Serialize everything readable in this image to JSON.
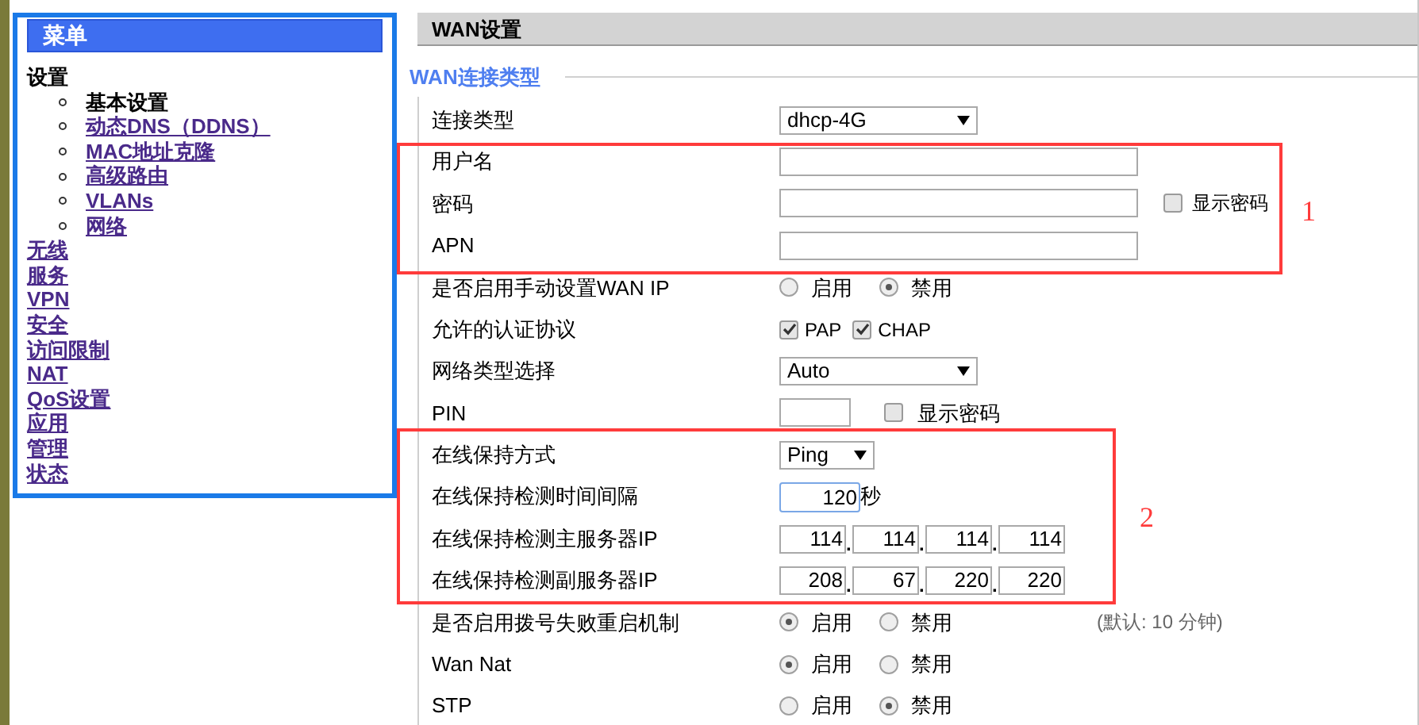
{
  "sidebar": {
    "title": "菜单",
    "items": [
      {
        "label": "设置",
        "selected": true,
        "children": [
          {
            "label": "基本设置",
            "selected": true
          },
          {
            "label": "动态DNS（DDNS）",
            "selected": false
          },
          {
            "label": "MAC地址克隆",
            "selected": false
          },
          {
            "label": "高级路由",
            "selected": false
          },
          {
            "label": "VLANs",
            "selected": false
          },
          {
            "label": "网络",
            "selected": false
          }
        ]
      },
      {
        "label": "无线",
        "selected": false
      },
      {
        "label": "服务",
        "selected": false
      },
      {
        "label": "VPN",
        "selected": false
      },
      {
        "label": "安全",
        "selected": false
      },
      {
        "label": "访问限制",
        "selected": false
      },
      {
        "label": "NAT",
        "selected": false
      },
      {
        "label": "QoS设置",
        "selected": false
      },
      {
        "label": "应用",
        "selected": false
      },
      {
        "label": "管理",
        "selected": false
      },
      {
        "label": "状态",
        "selected": false
      }
    ]
  },
  "page_title": "WAN设置",
  "section": {
    "title": "WAN连接类型",
    "rows": [
      {
        "kind": "select",
        "label": "连接类型",
        "value": "dhcp-4G"
      },
      {
        "kind": "text",
        "label": "用户名"
      },
      {
        "kind": "password",
        "label": "密码",
        "show_password": {
          "label": "显示密码",
          "checked": false
        }
      },
      {
        "kind": "text",
        "label": "APN"
      },
      {
        "kind": "radio",
        "label": "是否启用手动设置WAN IP",
        "options": [
          {
            "label": "启用",
            "selected": false
          },
          {
            "label": "禁用",
            "selected": true
          }
        ]
      },
      {
        "kind": "checks",
        "label": "允许的认证协议",
        "options": [
          {
            "label": "PAP",
            "checked": true
          },
          {
            "label": "CHAP",
            "checked": true
          }
        ]
      },
      {
        "kind": "select",
        "label": "网络类型选择",
        "value": "Auto"
      },
      {
        "kind": "pin",
        "label": "PIN",
        "show_password": {
          "label": "显示密码",
          "checked": false
        }
      },
      {
        "kind": "shortselect",
        "label": "在线保持方式",
        "value": "Ping"
      },
      {
        "kind": "interval",
        "label": "在线保持检测时间间隔",
        "value": "120",
        "unit": "秒"
      },
      {
        "kind": "ip",
        "label": "在线保持检测主服务器IP",
        "octets": [
          "114",
          "114",
          "114",
          "114"
        ],
        "separators": [
          ".",
          ".",
          "."
        ]
      },
      {
        "kind": "ip",
        "label": "在线保持检测副服务器IP",
        "octets": [
          "208",
          "67",
          "220",
          "220"
        ],
        "separators": [
          ".",
          ".",
          "."
        ]
      },
      {
        "kind": "radio",
        "label": "是否启用拨号失败重启机制",
        "options": [
          {
            "label": "启用",
            "selected": true
          },
          {
            "label": "禁用",
            "selected": false
          }
        ],
        "note": "(默认: 10 分钟)"
      },
      {
        "kind": "radio",
        "label": "Wan Nat",
        "options": [
          {
            "label": "启用",
            "selected": true
          },
          {
            "label": "禁用",
            "selected": false
          }
        ]
      },
      {
        "kind": "radio",
        "label": "STP",
        "options": [
          {
            "label": "启用",
            "selected": false
          },
          {
            "label": "禁用",
            "selected": true
          }
        ]
      }
    ]
  },
  "annotations": [
    "1",
    "2"
  ]
}
